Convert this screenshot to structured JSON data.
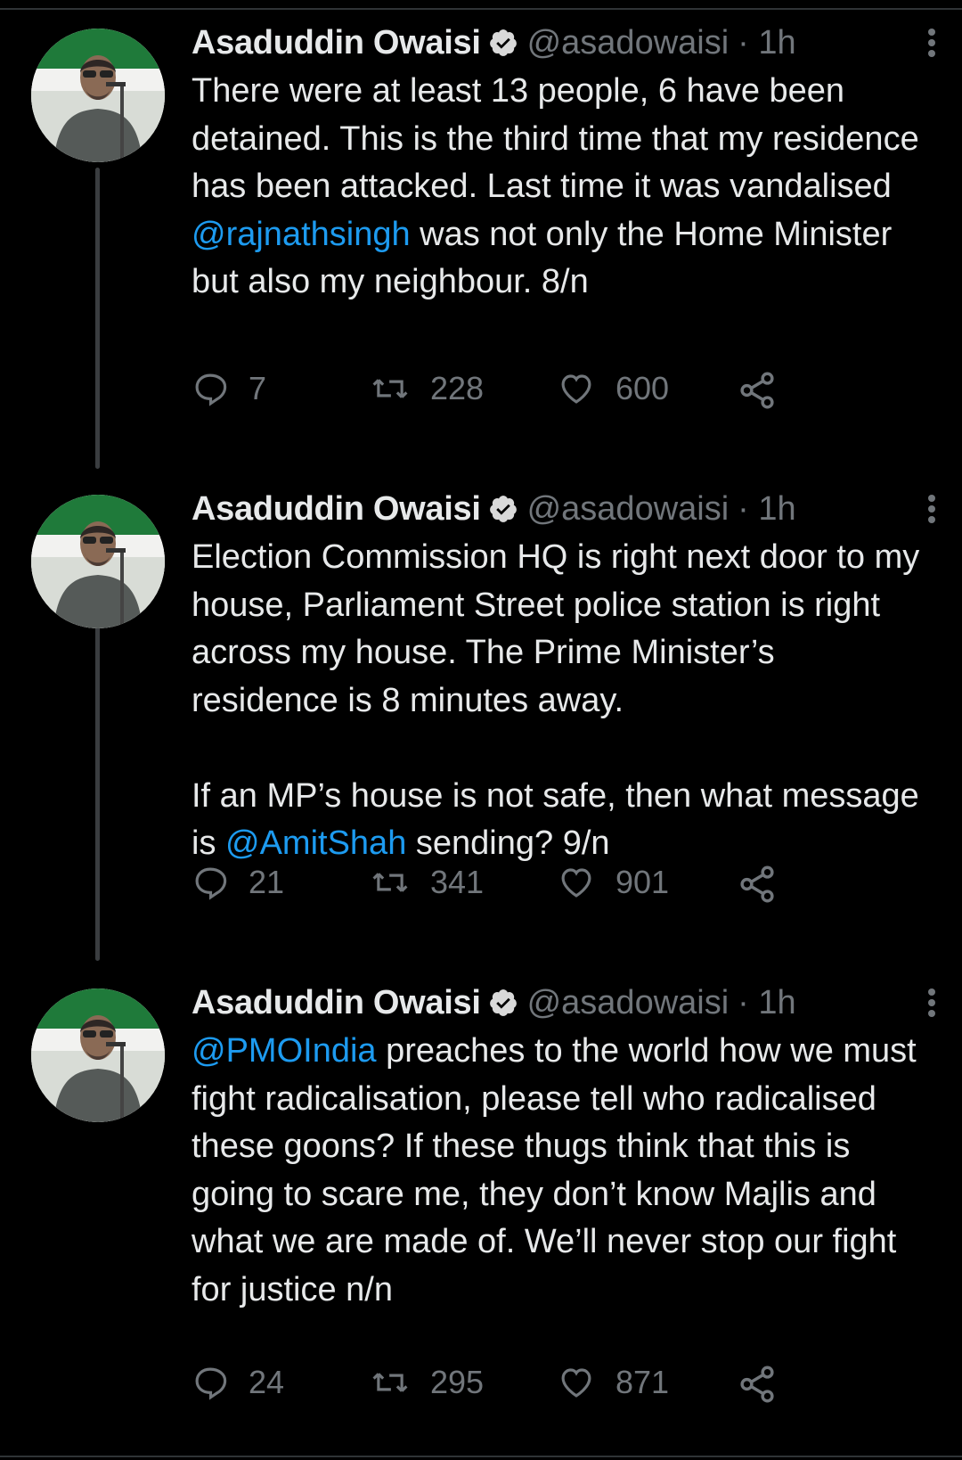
{
  "author": {
    "name": "Asaduddin Owaisi",
    "handle": "@asadowaisi",
    "verified_icon": "verified-badge-icon",
    "avatar_icon": "profile-photo"
  },
  "tweets": [
    {
      "time": "· 1h",
      "text_before": "There were at least 13 people, 6 have been detained. This is the third time that my residence has been attacked. Last time it was vandalised ",
      "mention": "@rajnathsingh",
      "text_after": " was not only the Home Minister but also my neighbour. 8/n",
      "replies": "7",
      "retweets": "228",
      "likes": "600"
    },
    {
      "time": "· 1h",
      "text_before": "Election Commission HQ is right next door to my house, Parliament Street police station is right across my house. The Prime Minister’s residence is 8 minutes away.\n\nIf an MP’s house is not safe, then what message is ",
      "mention": "@AmitShah",
      "text_after": " sending? 9/n",
      "replies": "21",
      "retweets": "341",
      "likes": "901"
    },
    {
      "time": "· 1h",
      "text_before": "",
      "mention": "@PMOIndia",
      "text_after": " preaches to the world how we must fight radicalisation, please tell who radicalised these goons? If these thugs think that this is going to scare me, they don’t know Majlis and what we are made of. We’ll never stop our fight for justice n/n",
      "replies": "24",
      "retweets": "295",
      "likes": "871"
    }
  ],
  "colors": {
    "background": "#000000",
    "text": "#e7e9ea",
    "muted": "#71767b",
    "link": "#1d9bf0"
  }
}
